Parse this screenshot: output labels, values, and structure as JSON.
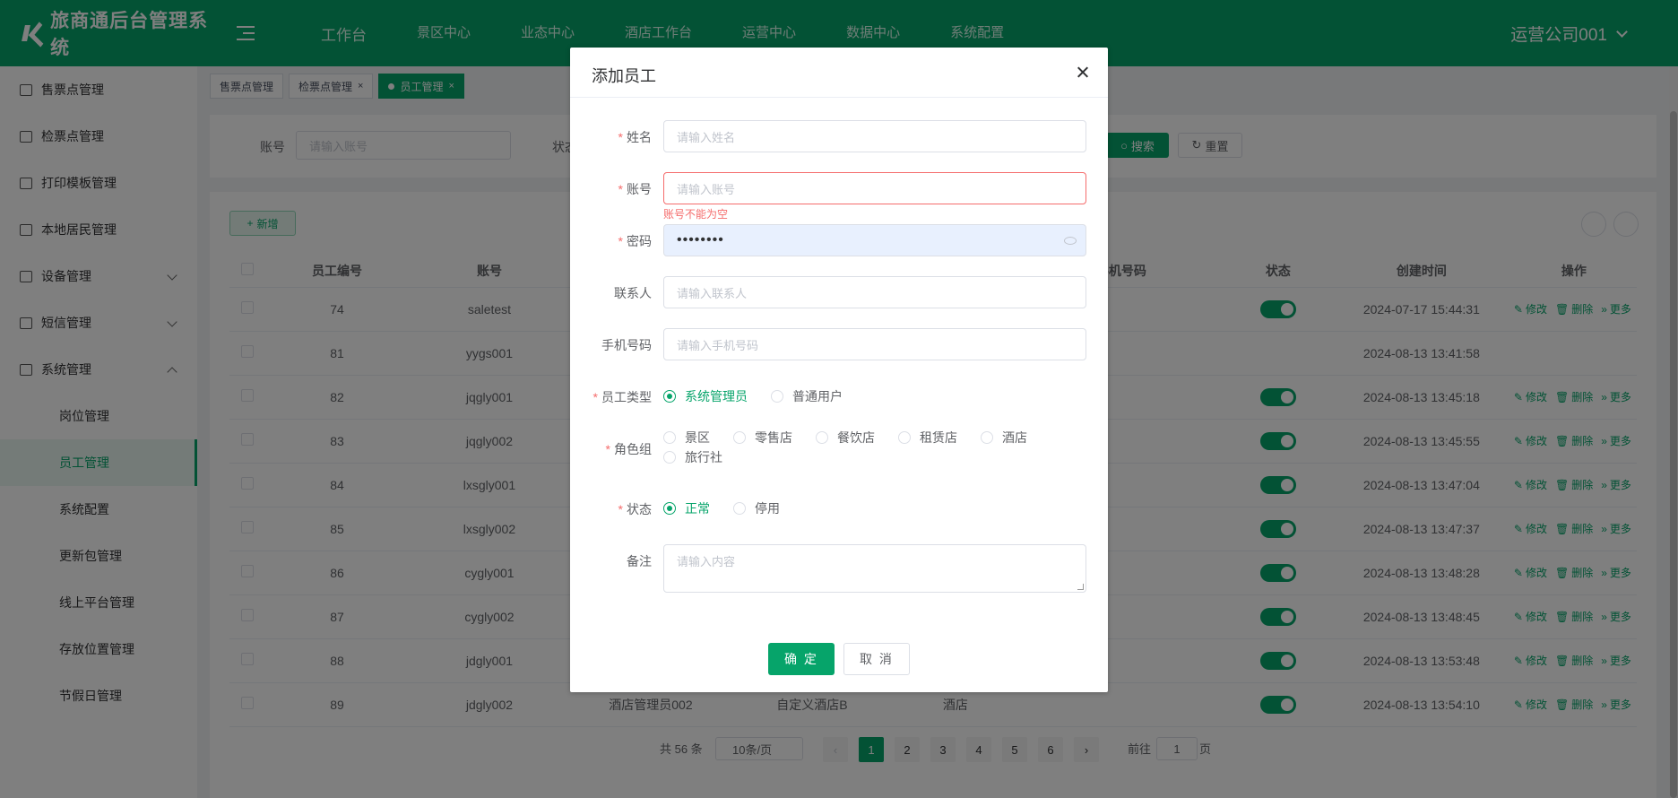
{
  "header": {
    "logo_text": "旅商通后台管理系统",
    "nav": [
      "工作台",
      "景区中心",
      "业态中心",
      "酒店工作台",
      "运营中心",
      "数据中心",
      "系统配置"
    ],
    "user": "运营公司001"
  },
  "sidebar": {
    "items": [
      {
        "label": "售票点管理",
        "icon": "ticket-point-icon"
      },
      {
        "label": "检票点管理",
        "icon": "check-point-icon"
      },
      {
        "label": "打印模板管理",
        "icon": "print-template-icon"
      },
      {
        "label": "本地居民管理",
        "icon": "resident-icon"
      },
      {
        "label": "设备管理",
        "icon": "device-icon"
      },
      {
        "label": "短信管理",
        "icon": "sms-icon"
      },
      {
        "label": "系统管理",
        "icon": "system-icon"
      }
    ],
    "sub_items": [
      "岗位管理",
      "员工管理",
      "系统配置",
      "更新包管理",
      "线上平台管理",
      "存放位置管理",
      "节假日管理"
    ]
  },
  "tags": [
    {
      "label": "售票点管理"
    },
    {
      "label": "检票点管理"
    },
    {
      "label": "员工管理"
    }
  ],
  "search": {
    "account_label": "账号",
    "account_placeholder": "请输入账号",
    "status_label": "状态",
    "search_btn": "搜索",
    "reset_btn": "重置"
  },
  "toolbar": {
    "add_btn": "新增"
  },
  "table": {
    "headers": [
      "员工编号",
      "账号",
      "",
      "",
      "",
      "手机号码",
      "状态",
      "创建时间",
      "操作"
    ],
    "ops": [
      "修改",
      "删除",
      "更多"
    ],
    "rows": [
      {
        "id": "74",
        "account": "saletest",
        "c3": "",
        "c4": "",
        "c5": "",
        "phone": "",
        "status": true,
        "created": "2024-07-17 15:44:31",
        "ops": true
      },
      {
        "id": "81",
        "account": "yygs001",
        "c3": "",
        "c4": "",
        "c5": "",
        "phone": "",
        "status": false,
        "created": "2024-08-13 13:41:58",
        "ops": false
      },
      {
        "id": "82",
        "account": "jqgly001",
        "c3": "",
        "c4": "",
        "c5": "",
        "phone": "",
        "status": true,
        "created": "2024-08-13 13:45:18",
        "ops": true
      },
      {
        "id": "83",
        "account": "jqgly002",
        "c3": "",
        "c4": "",
        "c5": "",
        "phone": "",
        "status": true,
        "created": "2024-08-13 13:45:55",
        "ops": true
      },
      {
        "id": "84",
        "account": "lxsgly001",
        "c3": "",
        "c4": "",
        "c5": "",
        "phone": "",
        "status": true,
        "created": "2024-08-13 13:47:04",
        "ops": true
      },
      {
        "id": "85",
        "account": "lxsgly002",
        "c3": "",
        "c4": "",
        "c5": "",
        "phone": "",
        "status": true,
        "created": "2024-08-13 13:47:37",
        "ops": true
      },
      {
        "id": "86",
        "account": "cygly001",
        "c3": "",
        "c4": "",
        "c5": "",
        "phone": "",
        "status": true,
        "created": "2024-08-13 13:48:28",
        "ops": true
      },
      {
        "id": "87",
        "account": "cygly002",
        "c3": "",
        "c4": "",
        "c5": "",
        "phone": "",
        "status": true,
        "created": "2024-08-13 13:48:45",
        "ops": true
      },
      {
        "id": "88",
        "account": "jdgly001",
        "c3": "",
        "c4": "",
        "c5": "",
        "phone": "",
        "status": true,
        "created": "2024-08-13 13:53:48",
        "ops": true
      },
      {
        "id": "89",
        "account": "jdgly002",
        "c3": "酒店管理员002",
        "c4": "自定义酒店B",
        "c5": "酒店",
        "phone": "",
        "status": true,
        "created": "2024-08-13 13:54:10",
        "ops": true
      }
    ]
  },
  "pager": {
    "total": "共 56 条",
    "size": "10条/页",
    "pages": [
      "1",
      "2",
      "3",
      "4",
      "5",
      "6"
    ],
    "current": "1",
    "goto_label": "前往",
    "goto_value": "1",
    "page_suffix": "页"
  },
  "dialog": {
    "title": "添加员工",
    "fields": {
      "name": {
        "label": "姓名",
        "placeholder": "请输入姓名"
      },
      "account": {
        "label": "账号",
        "placeholder": "请输入账号",
        "error": "账号不能为空"
      },
      "password": {
        "label": "密码",
        "value": "••••••••"
      },
      "contact": {
        "label": "联系人",
        "placeholder": "请输入联系人"
      },
      "phone": {
        "label": "手机号码",
        "placeholder": "请输入手机号码"
      },
      "type": {
        "label": "员工类型",
        "options": [
          "系统管理员",
          "普通用户"
        ],
        "selected": "系统管理员"
      },
      "roles": {
        "label": "角色组",
        "options": [
          "景区",
          "零售店",
          "餐饮店",
          "租赁店",
          "酒店",
          "旅行社"
        ]
      },
      "status": {
        "label": "状态",
        "options": [
          "正常",
          "停用"
        ],
        "selected": "正常"
      },
      "remark": {
        "label": "备注",
        "placeholder": "请输入内容"
      }
    },
    "ok": "确 定",
    "cancel": "取 消"
  },
  "colors": {
    "primary": "#06a46a",
    "error": "#f56c6c"
  }
}
